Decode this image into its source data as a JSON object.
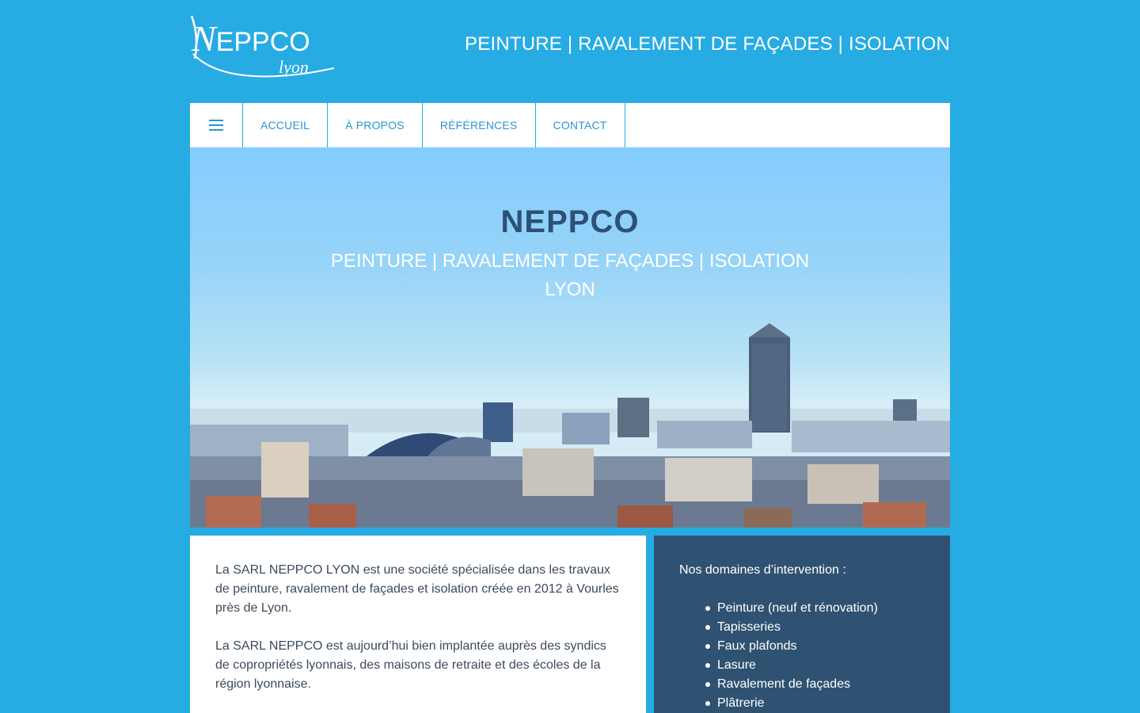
{
  "header": {
    "logo_main_initial": "N",
    "logo_main_rest": "EPPCO",
    "logo_sub": "lyon",
    "tagline": "PEINTURE | RAVALEMENT DE FAÇADES | ISOLATION"
  },
  "nav": {
    "menu_icon": "hamburger-menu-icon",
    "items": [
      {
        "label": "ACCUEIL"
      },
      {
        "label": "À PROPOS"
      },
      {
        "label": "RÉFÉRENCES"
      },
      {
        "label": "CONTACT"
      }
    ]
  },
  "hero": {
    "title": "NEPPCO",
    "subtitle_line1": "PEINTURE | RAVALEMENT DE FAÇADES | ISOLATION",
    "subtitle_line2": "LYON"
  },
  "intro": {
    "paragraph1": "La SARL NEPPCO LYON est une société spécialisée dans les travaux de peinture, ravalement de façades et isolation créée en 2012 à Vourles près de Lyon.",
    "paragraph2": "La SARL NEPPCO est aujourd’hui bien implantée auprès des syndics de copropriétés lyonnais, des maisons de retraite et des écoles de la région lyonnaise."
  },
  "domains": {
    "heading": "Nos domaines d’intervention :",
    "items": [
      "Peinture (neuf et rénovation)",
      "Tapisseries",
      "Faux plafonds",
      "Lasure",
      "Ravalement de façades",
      "Plâtrerie"
    ]
  },
  "colors": {
    "page_background": "#27abe3",
    "nav_text": "#2a95d4",
    "hero_title": "#2d5074",
    "panel_dark": "#2f5272"
  }
}
